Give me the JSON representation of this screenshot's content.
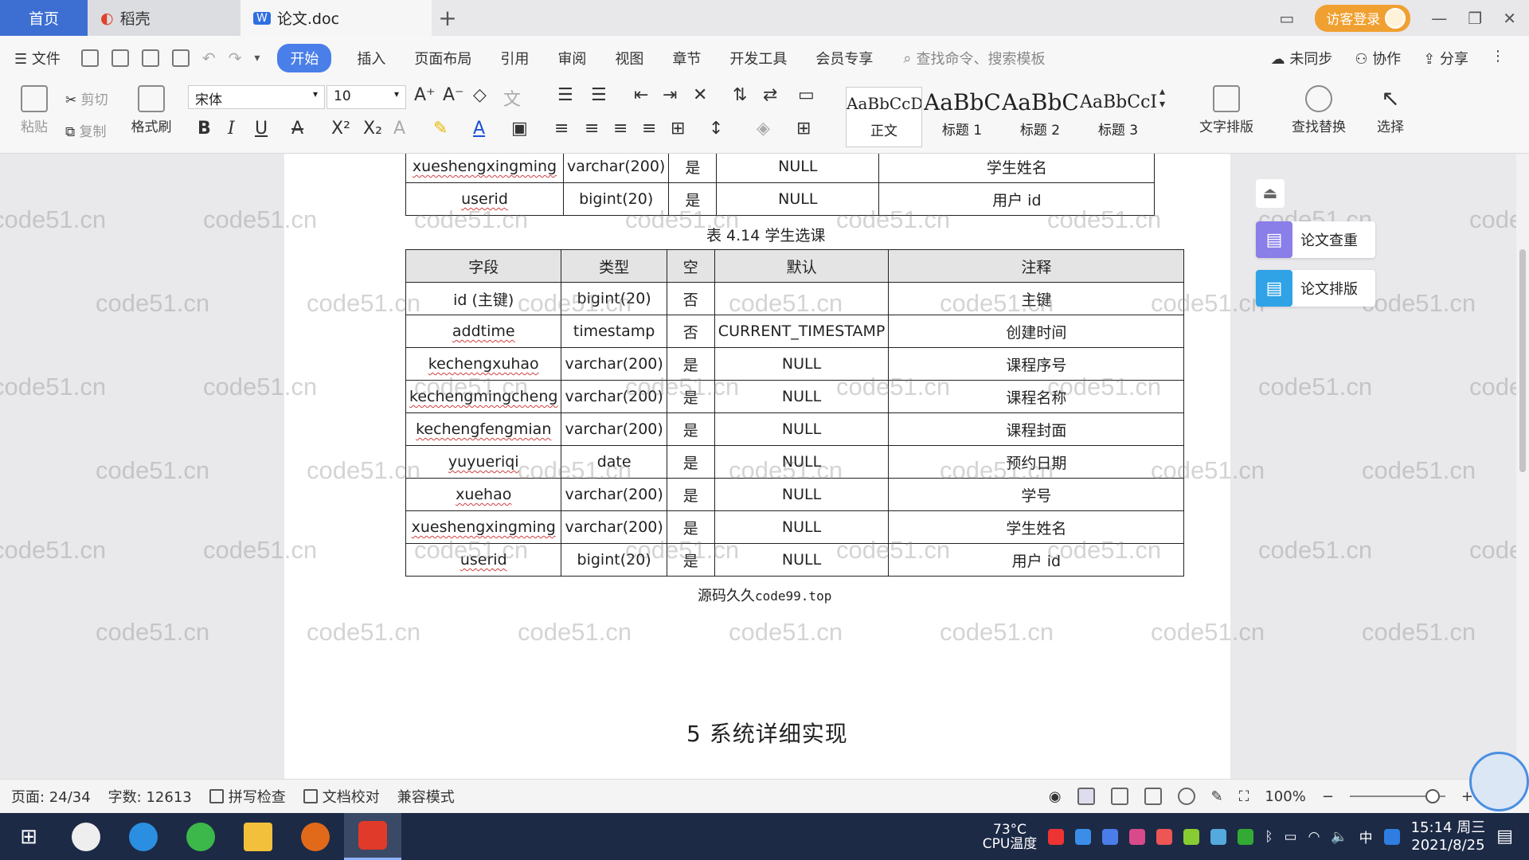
{
  "titlebar": {
    "tabs": [
      {
        "label": "首页"
      },
      {
        "label": "稻壳"
      },
      {
        "label": "论文.doc"
      }
    ],
    "login_label": "访客登录"
  },
  "menubar": {
    "file_label": "文件",
    "items": [
      "开始",
      "插入",
      "页面布局",
      "引用",
      "审阅",
      "视图",
      "章节",
      "开发工具",
      "会员专享"
    ],
    "search_placeholder": "查找命令、搜索模板",
    "right": [
      "未同步",
      "协作",
      "分享"
    ]
  },
  "ribbon": {
    "paste": "粘贴",
    "cut": "剪切",
    "copy": "复制",
    "format_painter": "格式刷",
    "font_name": "宋体",
    "font_size": "10",
    "styles": [
      {
        "sample": "AaBbCcDd",
        "label": "正文"
      },
      {
        "sample": "AaBbC",
        "label": "标题 1"
      },
      {
        "sample": "AaBbC",
        "label": "标题 2"
      },
      {
        "sample": "AaBbCcI",
        "label": "标题 3"
      }
    ],
    "text_layout": "文字排版",
    "find_replace": "查找替换",
    "select": "选择"
  },
  "document": {
    "prev_table_rows": [
      [
        "xueshengxingming",
        "varchar(200)",
        "是",
        "NULL",
        "学生姓名"
      ],
      [
        "userid",
        "bigint(20)",
        "是",
        "NULL",
        "用户 id"
      ]
    ],
    "caption": "表 4.14  学生选课",
    "table_headers": [
      "字段",
      "类型",
      "空",
      "默认",
      "注释"
    ],
    "table_rows": [
      [
        "id (主键)",
        "bigint(20)",
        "否",
        "",
        "主键"
      ],
      [
        "addtime",
        "timestamp",
        "否",
        "CURRENT_TIMESTAMP",
        "创建时间"
      ],
      [
        "kechengxuhao",
        "varchar(200)",
        "是",
        "NULL",
        "课程序号"
      ],
      [
        "kechengmingcheng",
        "varchar(200)",
        "是",
        "NULL",
        "课程名称"
      ],
      [
        "kechengfengmian",
        "varchar(200)",
        "是",
        "NULL",
        "课程封面"
      ],
      [
        "yuyueriqi",
        "date",
        "是",
        "NULL",
        "预约日期"
      ],
      [
        "xuehao",
        "varchar(200)",
        "是",
        "NULL",
        "学号"
      ],
      [
        "xueshengxingming",
        "varchar(200)",
        "是",
        "NULL",
        "学生姓名"
      ],
      [
        "userid",
        "bigint(20)",
        "是",
        "NULL",
        "用户 id"
      ]
    ],
    "overlay_cn": "源码久久",
    "overlay_url": "code99.top",
    "section_heading": "5 系统详细实现",
    "watermark": "code51.cn"
  },
  "side_panel": {
    "check": "论文查重",
    "layout": "论文排版"
  },
  "statusbar": {
    "page": "页面: 24/34",
    "words": "字数: 12613",
    "spell": "拼写检查",
    "proof": "文档校对",
    "compat": "兼容模式",
    "zoom": "100%"
  },
  "taskbar": {
    "temp": "73°C",
    "temp_label": "CPU温度",
    "ime": "中",
    "time": "15:14 周三",
    "date": "2021/8/25"
  }
}
